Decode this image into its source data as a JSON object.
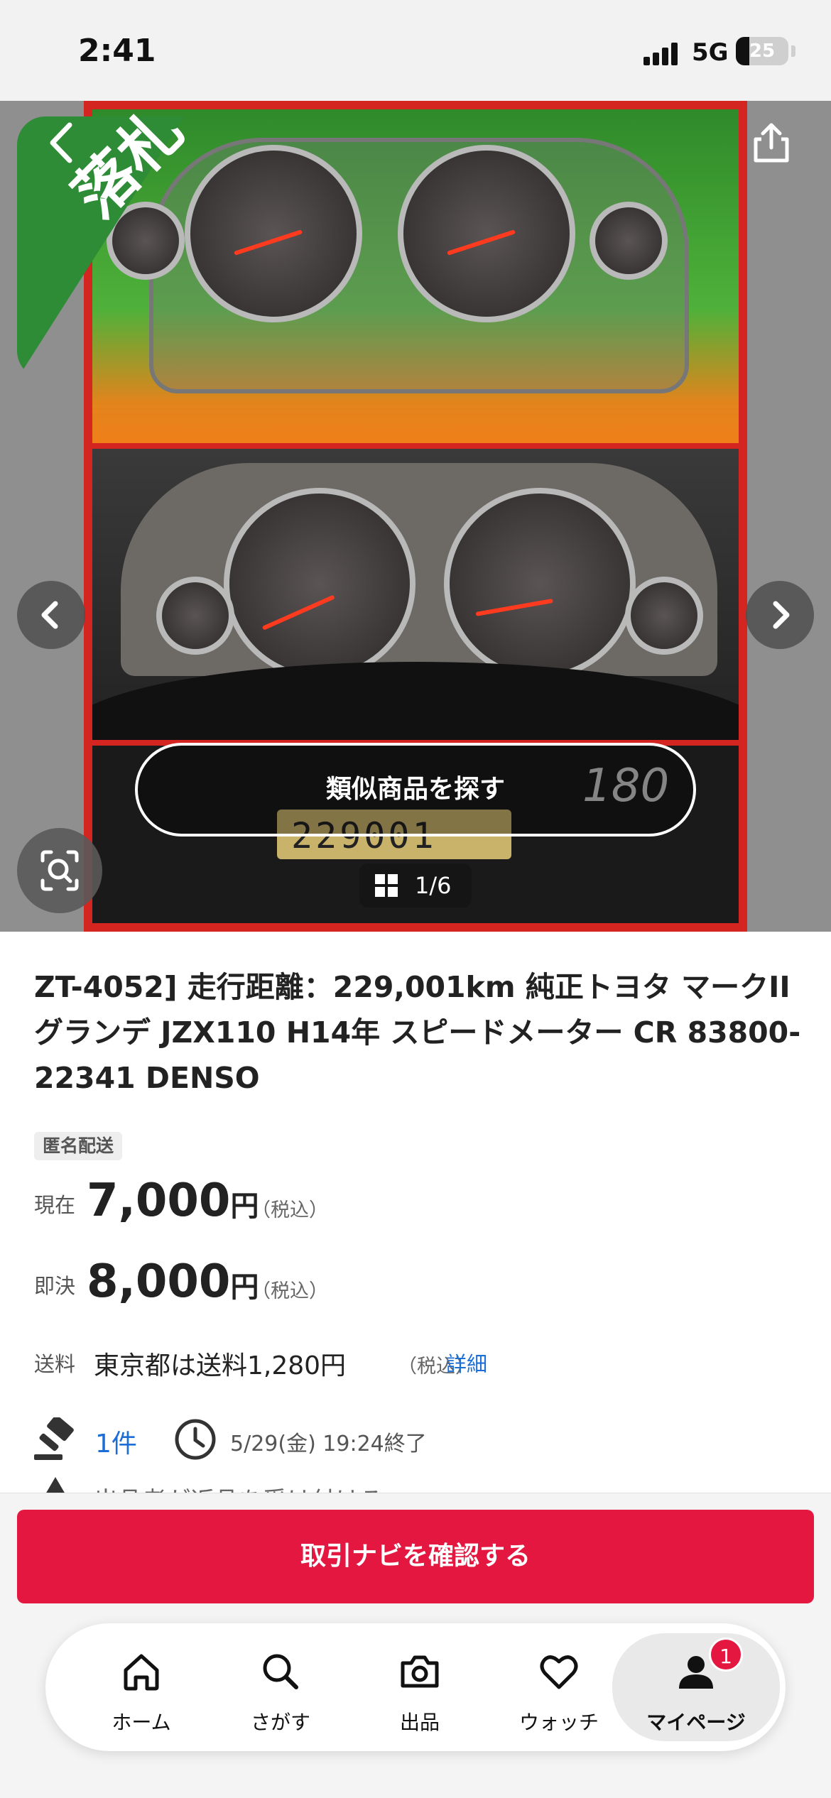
{
  "status_bar": {
    "time": "2:41",
    "network": "5G",
    "battery_level": "25",
    "battery_fraction": 0.25
  },
  "gallery": {
    "sold_label": "落札",
    "similar_button": "類似商品を探す",
    "counter": "1/6",
    "odometer_reading": "229001",
    "speedo_mark": "180",
    "icons": [
      "chevron-left-icon",
      "share-icon",
      "lens-search-icon",
      "grid-icon",
      "chevron-right-icon"
    ]
  },
  "item": {
    "title": "ZT-4052] 走行距離：229,001km 純正トヨタ マークII グランデ JZX110 H14年 スピードメーター CR 83800-22341 DENSO",
    "tag": "匿名配送",
    "current": {
      "label": "現在",
      "amount": "7,000",
      "unit": "円",
      "tax": "（税込）"
    },
    "buyout": {
      "label": "即決",
      "amount": "8,000",
      "unit": "円",
      "tax": "（税込）"
    },
    "shipping": {
      "label": "送料",
      "value": "東京都は送料1,280円",
      "tax": "（税込）",
      "detail_link": "詳細"
    },
    "bids": "1件",
    "end_time": "5/29(金) 19:24終了",
    "cut_text": "出品者が返品を受け付ける"
  },
  "cta": {
    "label": "取引ナビを確認する"
  },
  "tabbar": {
    "items": [
      {
        "label": "ホーム",
        "icon": "home-icon"
      },
      {
        "label": "さがす",
        "icon": "search-icon"
      },
      {
        "label": "出品",
        "icon": "camera-icon"
      },
      {
        "label": "ウォッチ",
        "icon": "heart-icon"
      },
      {
        "label": "マイページ",
        "icon": "person-icon",
        "badge": "1"
      }
    ]
  },
  "colors": {
    "accent": "#e3173f",
    "link": "#1c6ed6",
    "sold_banner": "#2e8b36",
    "photo_border": "#d52520"
  }
}
